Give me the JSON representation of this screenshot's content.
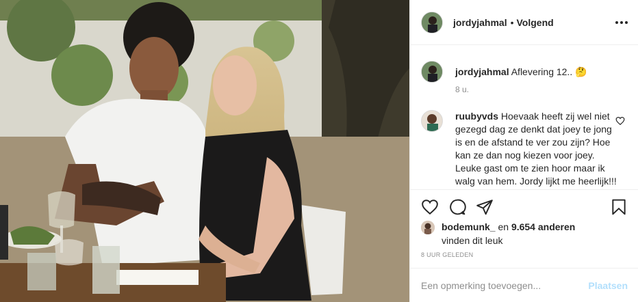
{
  "post": {
    "image_alt": "Photo of a man in a white t-shirt and a blonde woman in a black top seated at a dinner table outdoors",
    "author": "jordyjahmal",
    "separator": "•",
    "follow_status": "Volgend"
  },
  "caption": {
    "username": "jordyjahmal",
    "text": "Aflevering 12..",
    "emoji": "🤔",
    "time": "8 u."
  },
  "comments": [
    {
      "username": "ruubyvds",
      "text": "Hoevaak heeft zij wel niet gezegd dag ze denkt dat joey te jong is en de afstand te ver zou zijn? Hoe kan ze dan nog kiezen voor joey. Leuke gast om te zien hoor maar ik walg van hem. Jordy lijkt me heerlijk!!!"
    }
  ],
  "likes": {
    "liker": "bodemunk_",
    "connector": "en",
    "others": "9.654 anderen",
    "suffix": "vinden dit leuk"
  },
  "timestamp": "8 UUR GELEDEN",
  "add_comment": {
    "placeholder": "Een opmerking toevoegen...",
    "post_label": "Plaatsen"
  },
  "icons": {
    "like": "heart-icon",
    "comment": "comment-icon",
    "share": "share-icon",
    "save": "bookmark-icon",
    "more": "more-options-icon"
  },
  "colors": {
    "text": "#262626",
    "muted": "#8e8e8e",
    "post_button_disabled": "#b2dffc",
    "border": "#efefef"
  }
}
